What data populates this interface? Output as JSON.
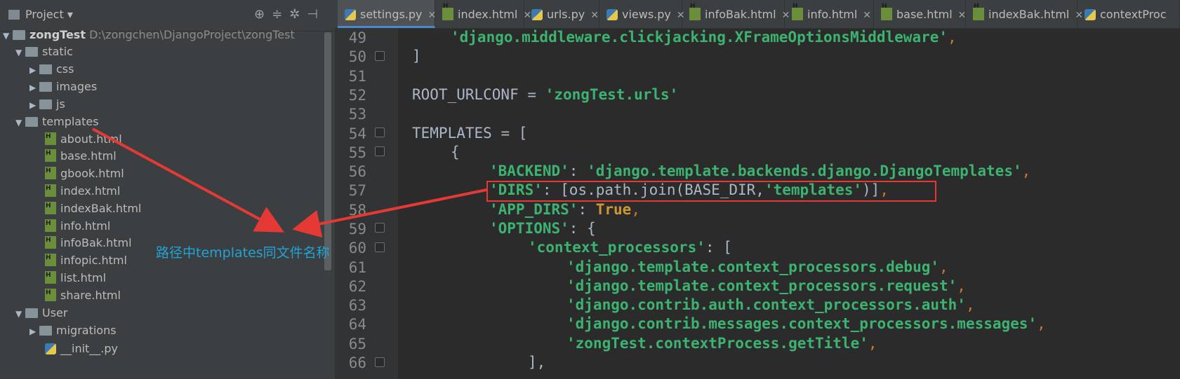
{
  "project_panel": {
    "title": "Project",
    "toolbar_icons": [
      "target-icon",
      "collapse-icon",
      "gear-icon",
      "hide-icon"
    ],
    "tree": [
      {
        "label": "zongTest",
        "path": "D:\\zongchen\\DjangoProject\\zongTest",
        "icon": "folder",
        "level": 0,
        "expanded": true
      },
      {
        "label": "static",
        "icon": "folder",
        "level": 1,
        "expanded": true
      },
      {
        "label": "css",
        "icon": "folder",
        "level": 2,
        "expanded": false
      },
      {
        "label": "images",
        "icon": "folder",
        "level": 2,
        "expanded": false
      },
      {
        "label": "js",
        "icon": "folder",
        "level": 2,
        "expanded": false
      },
      {
        "label": "templates",
        "icon": "folder",
        "level": 1,
        "expanded": true
      },
      {
        "label": "about.html",
        "icon": "html-file",
        "level": 2
      },
      {
        "label": "base.html",
        "icon": "html-file",
        "level": 2
      },
      {
        "label": "gbook.html",
        "icon": "html-file",
        "level": 2
      },
      {
        "label": "index.html",
        "icon": "html-file",
        "level": 2
      },
      {
        "label": "indexBak.html",
        "icon": "html-file",
        "level": 2
      },
      {
        "label": "info.html",
        "icon": "html-file",
        "level": 2
      },
      {
        "label": "infoBak.html",
        "icon": "html-file",
        "level": 2
      },
      {
        "label": "infopic.html",
        "icon": "html-file",
        "level": 2
      },
      {
        "label": "list.html",
        "icon": "html-file",
        "level": 2
      },
      {
        "label": "share.html",
        "icon": "html-file",
        "level": 2
      },
      {
        "label": "User",
        "icon": "folder",
        "level": 1,
        "expanded": true
      },
      {
        "label": "migrations",
        "icon": "folder",
        "level": 2,
        "expanded": false
      },
      {
        "label": "__init__.py",
        "icon": "python-file",
        "level": 2
      }
    ]
  },
  "annotation_text": "路径中templates同文件名称",
  "tabs": [
    {
      "label": "settings.py",
      "active": true
    },
    {
      "label": "index.html"
    },
    {
      "label": "urls.py"
    },
    {
      "label": "views.py"
    },
    {
      "label": "infoBak.html"
    },
    {
      "label": "info.html"
    },
    {
      "label": "base.html"
    },
    {
      "label": "indexBak.html"
    },
    {
      "label": "contextProc"
    }
  ],
  "line_numbers": [
    "49",
    "50",
    "51",
    "52",
    "53",
    "54",
    "55",
    "56",
    "57",
    "58",
    "59",
    "60",
    "61",
    "62",
    "63",
    "64",
    "65",
    "66"
  ],
  "code": {
    "l49": "'django.middleware.clickjacking.XFrameOptionsMiddleware'",
    "l50": "]",
    "l52a": "ROOT_URLCONF",
    "l52b": "'zongTest.urls'",
    "l54": "TEMPLATES",
    "l56a": "'BACKEND'",
    "l56b": "'django.template.backends.django.DjangoTemplates'",
    "l57a": "'DIRS'",
    "l57b": "os.path.join(BASE_DIR,",
    "l57c": "'templates'",
    "l58a": "'APP_DIRS'",
    "l58b": "True",
    "l59a": "'OPTIONS'",
    "l60a": "'context_processors'",
    "l61": "'django.template.context_processors.debug'",
    "l62": "'django.template.context_processors.request'",
    "l63": "'django.contrib.auth.context_processors.auth'",
    "l64": "'django.contrib.messages.context_processors.messages'",
    "l65": "'zongTest.contextProcess.getTitle'",
    "l66": "],"
  },
  "colors": {
    "string": "#3cb371",
    "keyword": "#cc9930",
    "annotation": "#22a3d6",
    "highlight": "#e53935"
  }
}
